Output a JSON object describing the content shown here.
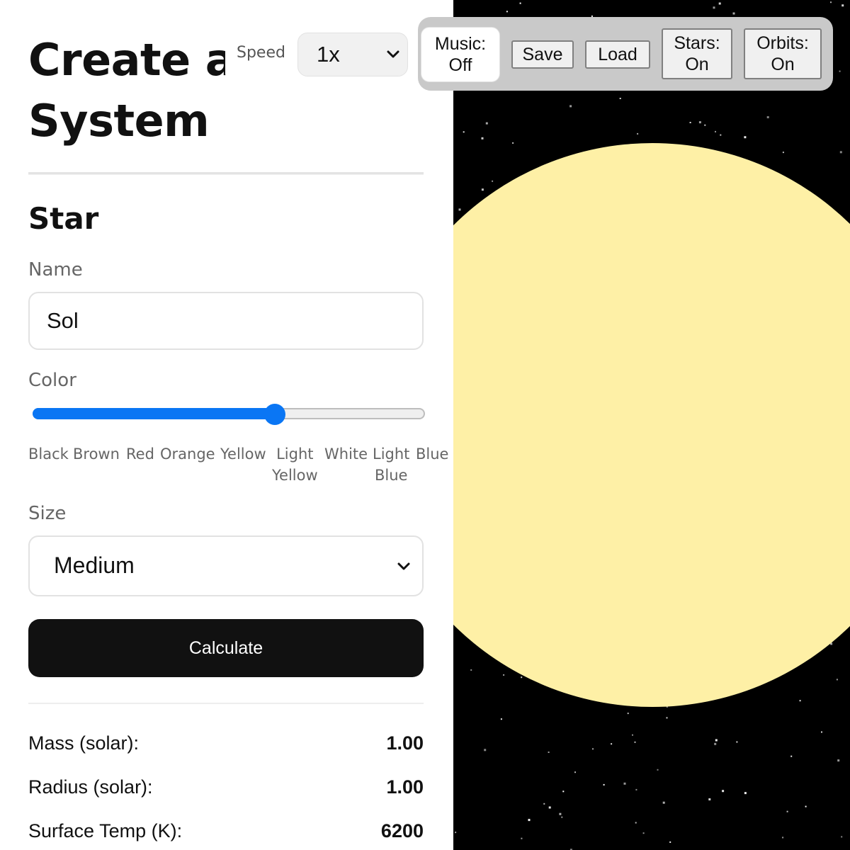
{
  "page": {
    "title_line1": "Create a",
    "title_line2": "System"
  },
  "star_section": {
    "heading": "Star",
    "name_label": "Name",
    "name_value": "Sol",
    "color_label": "Color",
    "color_slider_fraction": 0.62,
    "color_ticks": [
      {
        "line1": "Black",
        "line2": ""
      },
      {
        "line1": "Brown",
        "line2": ""
      },
      {
        "line1": "Red",
        "line2": ""
      },
      {
        "line1": "Orange",
        "line2": ""
      },
      {
        "line1": "Yellow",
        "line2": ""
      },
      {
        "line1": "Light",
        "line2": "Yellow"
      },
      {
        "line1": "White",
        "line2": ""
      },
      {
        "line1": "Light",
        "line2": "Blue"
      },
      {
        "line1": "Blue",
        "line2": ""
      }
    ],
    "size_label": "Size",
    "size_value": "Medium",
    "calculate_label": "Calculate"
  },
  "results": [
    {
      "label": "Mass (solar):",
      "value": "1.00"
    },
    {
      "label": "Radius (solar):",
      "value": "1.00"
    },
    {
      "label": "Surface Temp (K):",
      "value": "6200"
    }
  ],
  "toolbar": {
    "speed_label": "Speed",
    "speed_value": "1x",
    "music_line1": "Music:",
    "music_line2": "Off",
    "save_label": "Save",
    "load_label": "Load",
    "stars_line1": "Stars:",
    "stars_line2": "On",
    "orbits_line1": "Orbits:",
    "orbits_line2": "On"
  },
  "colors": {
    "accent": "#0a76f4",
    "star_fill": "#fef0a6",
    "space_bg": "#000000",
    "button_dark": "#111111"
  },
  "icons": {
    "dropdown": "chevron-down-icon"
  }
}
